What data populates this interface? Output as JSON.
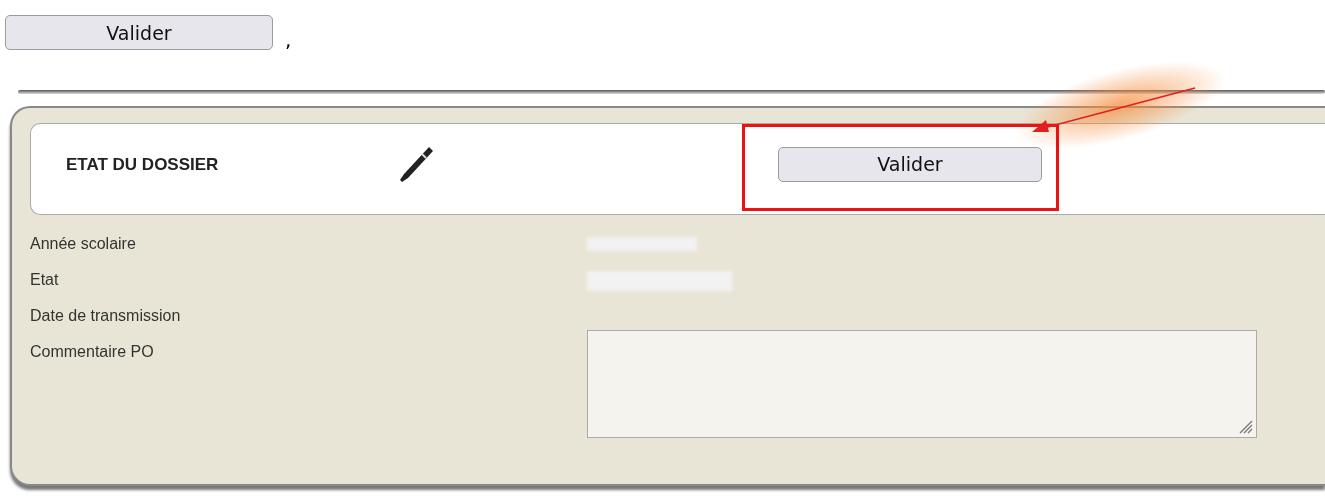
{
  "intro": {
    "button": "Valider",
    "punctuation": ","
  },
  "panel": {
    "title": "ETAT DU DOSSIER",
    "button": "Valider",
    "fields": [
      {
        "label": "Année scolaire",
        "kind": "redacted"
      },
      {
        "label": "Etat",
        "kind": "redacted"
      },
      {
        "label": "Date de transmission",
        "kind": "empty"
      },
      {
        "label": "Commentaire PO",
        "kind": "textarea"
      }
    ]
  }
}
